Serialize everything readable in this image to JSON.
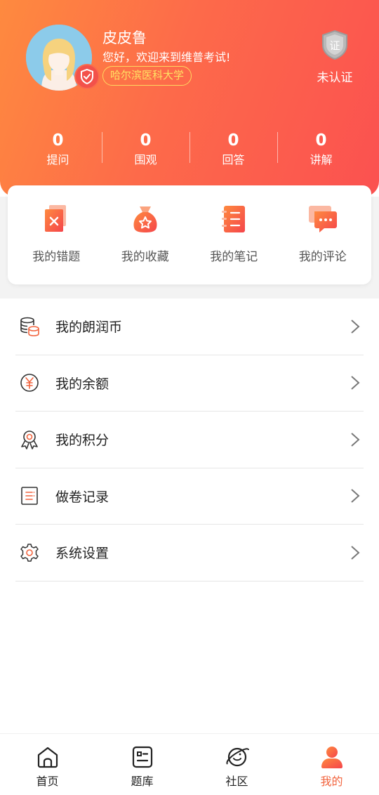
{
  "profile": {
    "username": "皮皮鲁",
    "greeting": "您好，欢迎来到维普考试!",
    "school": "哈尔滨医科大学",
    "cert_badge_text": "证",
    "cert_status": "未认证"
  },
  "stats": [
    {
      "value": "0",
      "label": "提问"
    },
    {
      "value": "0",
      "label": "围观"
    },
    {
      "value": "0",
      "label": "回答"
    },
    {
      "value": "0",
      "label": "讲解"
    }
  ],
  "quick_actions": [
    {
      "label": "我的错题",
      "icon": "wrong-questions-icon"
    },
    {
      "label": "我的收藏",
      "icon": "favorites-bag-icon"
    },
    {
      "label": "我的笔记",
      "icon": "notebook-icon"
    },
    {
      "label": "我的评论",
      "icon": "comment-bubble-icon"
    }
  ],
  "menu": [
    {
      "label": "我的朗润币",
      "icon": "coins-stack-icon"
    },
    {
      "label": "我的余额",
      "icon": "yuan-coin-icon"
    },
    {
      "label": "我的积分",
      "icon": "medal-icon"
    },
    {
      "label": "做卷记录",
      "icon": "record-list-icon"
    },
    {
      "label": "系统设置",
      "icon": "gear-icon"
    }
  ],
  "tabs": [
    {
      "label": "首页",
      "icon": "home-icon",
      "active": false
    },
    {
      "label": "题库",
      "icon": "question-bank-icon",
      "active": false
    },
    {
      "label": "社区",
      "icon": "planet-icon",
      "active": false
    },
    {
      "label": "我的",
      "icon": "user-icon",
      "active": true
    }
  ],
  "colors": {
    "header_gradient_start": "#fe8a3f",
    "header_gradient_end": "#fb5150",
    "accent": "#f2643e",
    "school_tag": "#ffe063"
  }
}
